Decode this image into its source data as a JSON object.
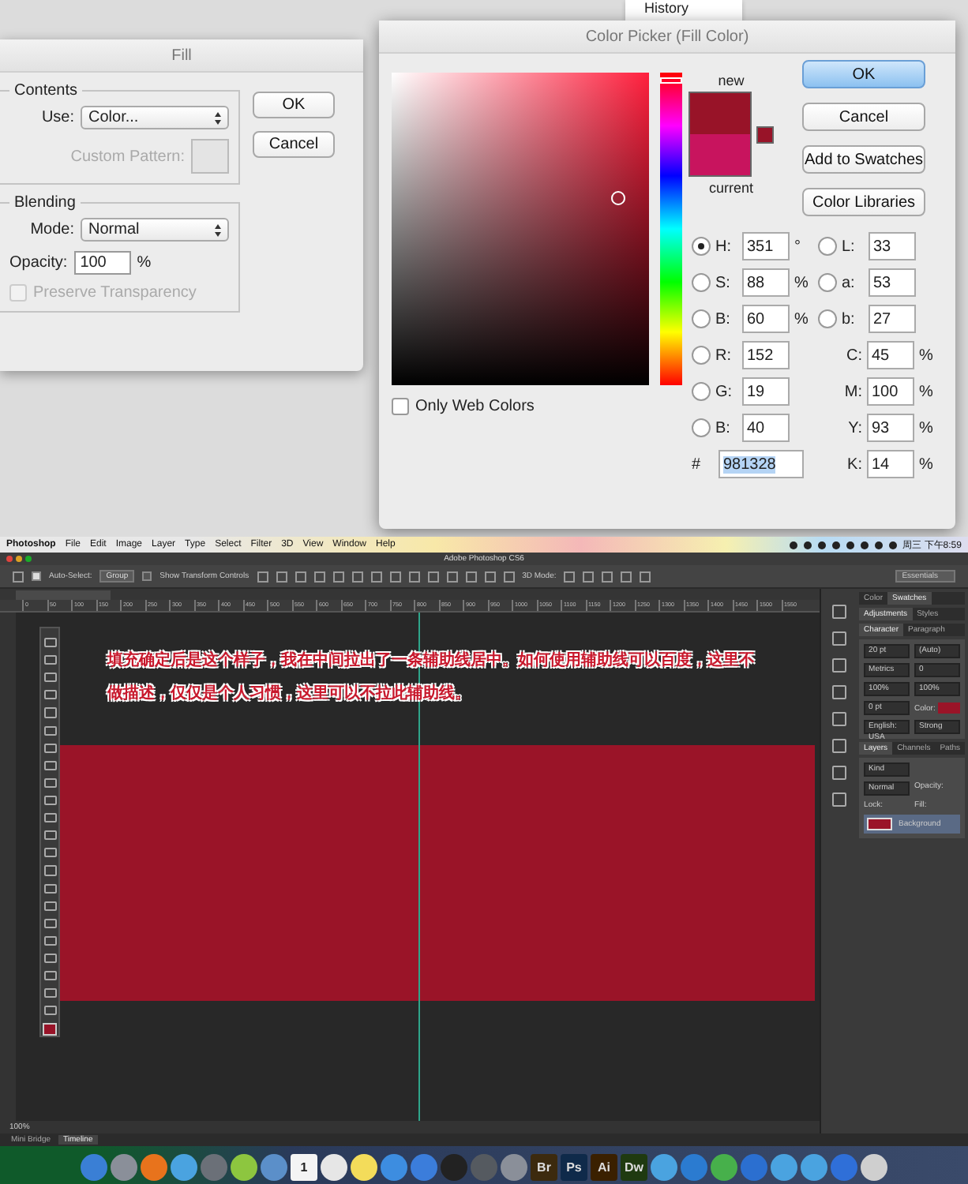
{
  "menu_fragment": {
    "item": "History"
  },
  "fill_dialog": {
    "title": "Fill",
    "contents_label": "Contents",
    "use_label": "Use:",
    "use_value": "Color...",
    "custom_pattern": {
      "label": "Custom Pattern:",
      "disabled": true
    },
    "blending_label": "Blending",
    "mode_label": "Mode:",
    "mode_value": "Normal",
    "opacity_label": "Opacity:",
    "opacity_value": "100",
    "opacity_unit": "%",
    "preserve_transparency": {
      "label": "Preserve Transparency",
      "checked": false,
      "disabled": true
    },
    "buttons": [
      "OK",
      "Cancel"
    ]
  },
  "color_picker": {
    "title": "Color Picker (Fill Color)",
    "swatches": [
      {
        "label": "new",
        "color": "#981328"
      },
      {
        "label": "current",
        "color": "#c8145e"
      }
    ],
    "buttons": [
      {
        "label": "OK",
        "default": true
      },
      {
        "label": "Cancel",
        "default": false
      },
      {
        "label": "Add to Swatches",
        "default": false
      },
      {
        "label": "Color Libraries",
        "default": false
      }
    ],
    "only_web_colors": {
      "label": "Only Web Colors",
      "checked": false
    },
    "hue_slider": {
      "level": 0.975
    },
    "fields_left": [
      {
        "kind": "radio",
        "label": "H:",
        "value": "351",
        "unit": "°",
        "selected": true
      },
      {
        "kind": "radio",
        "label": "S:",
        "value": "88",
        "unit": "%",
        "selected": false
      },
      {
        "kind": "radio",
        "label": "B:",
        "value": "60",
        "unit": "%",
        "selected": false
      },
      {
        "kind": "radio",
        "label": "R:",
        "value": "152",
        "selected": false
      },
      {
        "kind": "radio",
        "label": "G:",
        "value": "19",
        "selected": false
      },
      {
        "kind": "radio",
        "label": "B:",
        "value": "40",
        "selected": false
      },
      {
        "kind": "hex",
        "label": "#",
        "value": "981328"
      }
    ],
    "fields_right": [
      {
        "kind": "radio",
        "label": "L:",
        "value": "33",
        "selected": false
      },
      {
        "kind": "radio",
        "label": "a:",
        "value": "53",
        "selected": false
      },
      {
        "kind": "radio",
        "label": "b:",
        "value": "27",
        "selected": false
      },
      {
        "kind": "plain",
        "label": "C:",
        "value": "45",
        "unit": "%"
      },
      {
        "kind": "plain",
        "label": "M:",
        "value": "100",
        "unit": "%"
      },
      {
        "kind": "plain",
        "label": "Y:",
        "value": "93",
        "unit": "%"
      },
      {
        "kind": "plain",
        "label": "K:",
        "value": "14",
        "unit": "%"
      }
    ]
  },
  "photoshop": {
    "menu_bar": {
      "items": [
        {
          "label": "Photoshop",
          "bold": true
        },
        {
          "label": "File",
          "bold": false
        },
        {
          "label": "Edit",
          "bold": false
        },
        {
          "label": "Image",
          "bold": false
        },
        {
          "label": "Layer",
          "bold": false
        },
        {
          "label": "Type",
          "bold": false
        },
        {
          "label": "Select",
          "bold": false
        },
        {
          "label": "Filter",
          "bold": false
        },
        {
          "label": "3D",
          "bold": false
        },
        {
          "label": "View",
          "bold": false
        },
        {
          "label": "Window",
          "bold": false
        },
        {
          "label": "Help",
          "bold": false
        }
      ],
      "clock": "周三 下午8:59"
    },
    "title": "Adobe Photoshop CS6",
    "options_bar": {
      "auto_select": {
        "label": "Auto-Select:",
        "checked": true
      },
      "auto_select_value": "Group",
      "show_transform": {
        "label": "Show Transform Controls",
        "checked": false
      },
      "mode_label": "3D Mode:",
      "workspace": "Essentials"
    },
    "ruler": [
      "0",
      "50",
      "100",
      "150",
      "200",
      "250",
      "300",
      "350",
      "400",
      "450",
      "500",
      "550",
      "600",
      "650",
      "700",
      "750",
      "800",
      "850",
      "900",
      "950",
      "1000",
      "1050",
      "1100",
      "1150",
      "1200",
      "1250",
      "1300",
      "1350",
      "1400",
      "1450",
      "1500",
      "1550"
    ],
    "annotation": "填充确定后是这个样子，我在中间拉出了一条辅助线居中。如何使用辅助线可以百度，这里不做描述，仅仅是个人习惯，这里可以不拉此辅助线。",
    "panel_tabs": [
      [
        {
          "label": "Color",
          "selected": false
        },
        {
          "label": "Swatches",
          "selected": true
        }
      ],
      [
        {
          "label": "Adjustments",
          "selected": true
        },
        {
          "label": "Styles",
          "selected": false
        }
      ],
      [
        {
          "label": "Character",
          "selected": true
        },
        {
          "label": "Paragraph",
          "selected": false
        }
      ]
    ],
    "character": {
      "size": "20 pt",
      "leading": "(Auto)",
      "kerning": "Metrics",
      "tracking": "0",
      "vertical_scale": "100%",
      "horizontal_scale": "100%",
      "baseline": "0 pt",
      "color_label": "Color:",
      "language": "English: USA",
      "antialias": "Strong"
    },
    "layers_tabs": [
      {
        "label": "Layers",
        "selected": true
      },
      {
        "label": "Channels",
        "selected": false
      },
      {
        "label": "Paths",
        "selected": false
      }
    ],
    "layers": {
      "filter": "Kind",
      "blend_mode": "Normal",
      "opacity_label": "Opacity:",
      "lock_label": "Lock:",
      "fill_label": "Fill:",
      "layer": "Background"
    },
    "status": {
      "zoom": "100%"
    },
    "bottom_tabs": [
      {
        "label": "Mini Bridge",
        "selected": false
      },
      {
        "label": "Timeline",
        "selected": true
      }
    ],
    "dock": [
      {
        "kind": "icon",
        "color": "#3a7fd5"
      },
      {
        "kind": "icon",
        "color": "#8a8f99"
      },
      {
        "kind": "icon",
        "color": "#e8731c"
      },
      {
        "kind": "icon",
        "color": "#4aa3e0"
      },
      {
        "kind": "icon",
        "color": "#6b7078"
      },
      {
        "kind": "icon",
        "color": "#8dc63f"
      },
      {
        "kind": "icon",
        "color": "#5b8fc9"
      },
      {
        "kind": "label",
        "label": "1",
        "color": "#f4f4f4"
      },
      {
        "kind": "icon",
        "color": "#e6e6e6"
      },
      {
        "kind": "icon",
        "color": "#f3dc5a"
      },
      {
        "kind": "icon",
        "color": "#3d8de0"
      },
      {
        "kind": "icon",
        "color": "#3b7ddb"
      },
      {
        "kind": "icon",
        "color": "#222222"
      },
      {
        "kind": "icon",
        "color": "#555a60"
      },
      {
        "kind": "icon",
        "color": "#8a8f99"
      },
      {
        "kind": "label",
        "label": "Br",
        "color": "#3c2a0e"
      },
      {
        "kind": "label",
        "label": "Ps",
        "color": "#0f2a4a"
      },
      {
        "kind": "label",
        "label": "Ai",
        "color": "#3a2000"
      },
      {
        "kind": "label",
        "label": "Dw",
        "color": "#1f3a10"
      },
      {
        "kind": "icon",
        "color": "#4aa3e0"
      },
      {
        "kind": "icon",
        "color": "#2b7bd0"
      },
      {
        "kind": "icon",
        "color": "#47b04b"
      },
      {
        "kind": "icon",
        "color": "#2b6fd0"
      },
      {
        "kind": "icon",
        "color": "#4aa3e0"
      },
      {
        "kind": "icon",
        "color": "#4aa3e0"
      },
      {
        "kind": "icon",
        "color": "#2f6fd8"
      },
      {
        "kind": "icon",
        "color": "#cfcfcf"
      }
    ]
  }
}
